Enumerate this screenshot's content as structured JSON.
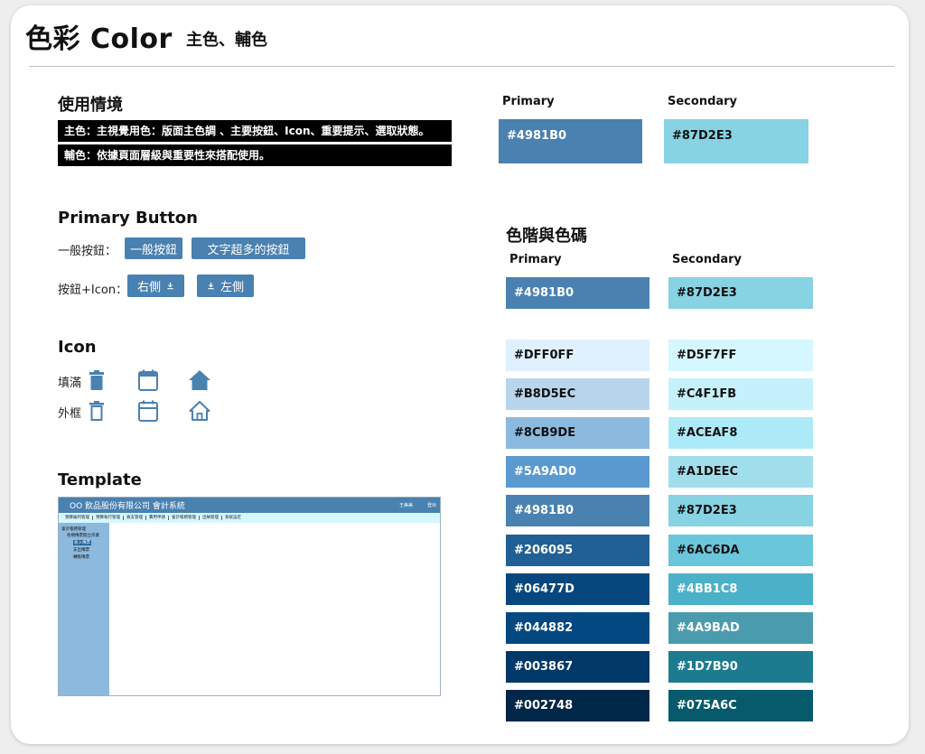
{
  "header": {
    "title": "色彩 Color",
    "subtitle": "主色、輔色"
  },
  "usage": {
    "heading": "使用情境",
    "primary_text": "主色：主視覺用色：版面主色調 、主要按鈕、Icon、重要提示、選取狀態。",
    "secondary_text": "輔色：依據頁面層級與重要性來搭配使用。"
  },
  "main_colors": {
    "primary_label": "Primary",
    "primary_hex": "#4981B0",
    "secondary_label": "Secondary",
    "secondary_hex": "#87D2E3"
  },
  "primary_button": {
    "heading": "Primary Button",
    "row1_label": "一般按鈕：",
    "btn_normal": "一般按鈕",
    "btn_long": "文字超多的按鈕",
    "row2_label": "按鈕+Icon：",
    "btn_right": "右側",
    "btn_left": "左側"
  },
  "icon_section": {
    "heading": "Icon",
    "filled_label": "填滿",
    "outline_label": "外框",
    "icons": [
      "trash-icon",
      "calendar-icon",
      "home-icon"
    ]
  },
  "template_section": {
    "heading": "Template",
    "app_title": "OO 飲品股份有限公司  會計系統",
    "user": "王美美",
    "logout": "登出",
    "menu": [
      "預算編列管理",
      "預算執行管理",
      "收支管理",
      "費用申請",
      "會計帳務管理",
      "出納管理",
      "系統設定"
    ],
    "tree": [
      "會計帳務管理",
      "各類傳票開立作業",
      "收入傳票",
      "支出傳票",
      "轉帳傳票"
    ]
  },
  "scale": {
    "heading": "色階與色碼",
    "primary_label": "Primary",
    "secondary_label": "Secondary",
    "primary_base": "#4981B0",
    "secondary_base": "#87D2E3",
    "primary": [
      "#DFF0FF",
      "#B8D5EC",
      "#8CB9DE",
      "#5A9AD0",
      "#4981B0",
      "#206095",
      "#06477D",
      "#044882",
      "#003867",
      "#002748"
    ],
    "secondary": [
      "#D5F7FF",
      "#C4F1FB",
      "#ACEAF8",
      "#A1DEEC",
      "#87D2E3",
      "#6AC6DA",
      "#4BB1C8",
      "#4A9BAD",
      "#1D7B90",
      "#075A6C"
    ]
  }
}
